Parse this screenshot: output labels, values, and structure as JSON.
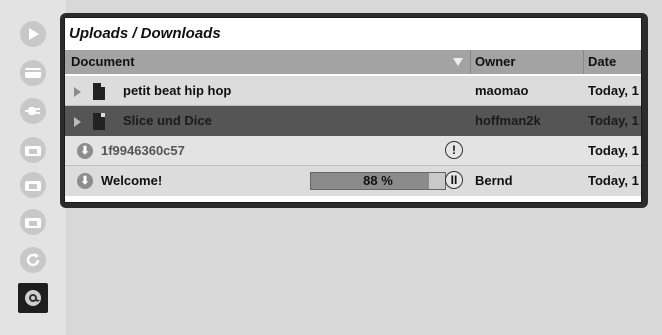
{
  "panel": {
    "title": "Uploads / Downloads"
  },
  "columns": {
    "document": "Document",
    "owner": "Owner",
    "date_added": "Date Add"
  },
  "rows": [
    {
      "document": "petit beat hip hop",
      "owner": "maomao",
      "date": "Today, 1"
    },
    {
      "document": "Slice und Dice",
      "owner": "hoffman2k",
      "date": "Today, 1"
    },
    {
      "document": "1f9946360c57",
      "owner": "",
      "date": "Today, 1",
      "status": "!"
    },
    {
      "document": "Welcome!",
      "owner": "Bernd",
      "date": "Today, 1",
      "progress_text": "88 %",
      "progress": 0.88,
      "status": "II"
    }
  ],
  "sidebar": {
    "icons": [
      "play-icon",
      "clip-icon",
      "plugin-icon",
      "folder-1-icon",
      "folder-2-icon",
      "folder-3-icon",
      "sync-icon",
      "at-sign-icon"
    ]
  },
  "colors": {
    "selected_row": "#555555",
    "header": "#a3a3a3",
    "active_sidebar": "#1e1e1e"
  }
}
